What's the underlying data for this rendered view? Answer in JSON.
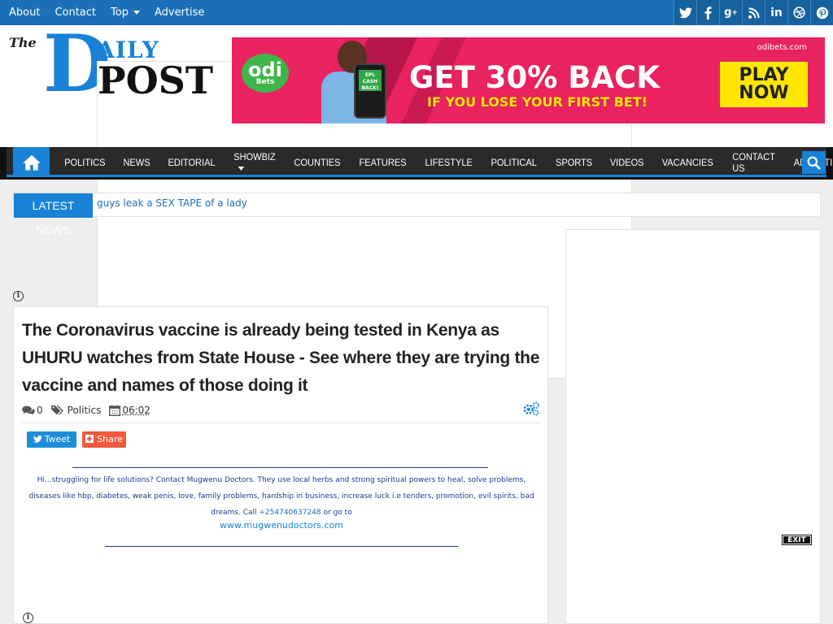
{
  "topbar": {
    "links": [
      "About",
      "Contact",
      "Top",
      "Advertise"
    ],
    "social_icons": [
      "twitter-icon",
      "facebook-icon",
      "google-plus-icon",
      "rss-icon",
      "linkedin-icon",
      "dribbble-icon",
      "pinterest-icon"
    ]
  },
  "logo": {
    "the": "The",
    "d": "D",
    "aily": "AILY",
    "post": "POST"
  },
  "banner": {
    "brand": "odi",
    "brand_sub": "Bets",
    "phone_text": "EPL CASH BACK!",
    "headline": "GET 30% BACK",
    "subline": "IF YOU LOSE YOUR FIRST BET!",
    "url": "odibets.com",
    "cta_line1": "PLAY",
    "cta_line2": "NOW"
  },
  "nav": {
    "items": [
      "POLITICS",
      "NEWS",
      "EDITORIAL",
      "SHOWBIZ",
      "COUNTIES",
      "FEATURES",
      "LIFESTYLE",
      "POLITICAL",
      "SPORTS",
      "VIDEOS",
      "VACANCIES",
      "CONTACT US",
      "ADVERTISE"
    ]
  },
  "ticker": {
    "label": "LATEST NEWS",
    "line1": "guys leak a SEX TAPE of a lady",
    "line2": "                                     "
  },
  "post": {
    "title": "The Coronavirus vaccine is already being tested in Kenya as UHURU watches from State House - See where they are trying the vaccine and names of those doing it",
    "comments": "0",
    "category": "Politics",
    "time": "06:02",
    "tweet_label": "Tweet",
    "share_label": "Share",
    "promo_text": "Hi...struggling for life solutions? Contact Mugwenu Doctors. They use local herbs and strong spiritual powers to heal, solve problems, diseases like hbp, diabetes, weak penis, love, family problems, hardship in business, increase luck i.e tenders, promotion, evil spirits, bad dreams. Call",
    "promo_phone": "+254740637248",
    "promo_tail": "or go to",
    "promo_link": "www.mugwenudoctors.com"
  },
  "sidebar": {
    "exit_label": "EXIT"
  },
  "colors": {
    "brand_blue": "#1a82d6",
    "topbar": "#1a6fb8",
    "nav_dark": "#2a2a2a",
    "banner_pink": "#e8235f",
    "cta_yellow": "#ffe600"
  }
}
